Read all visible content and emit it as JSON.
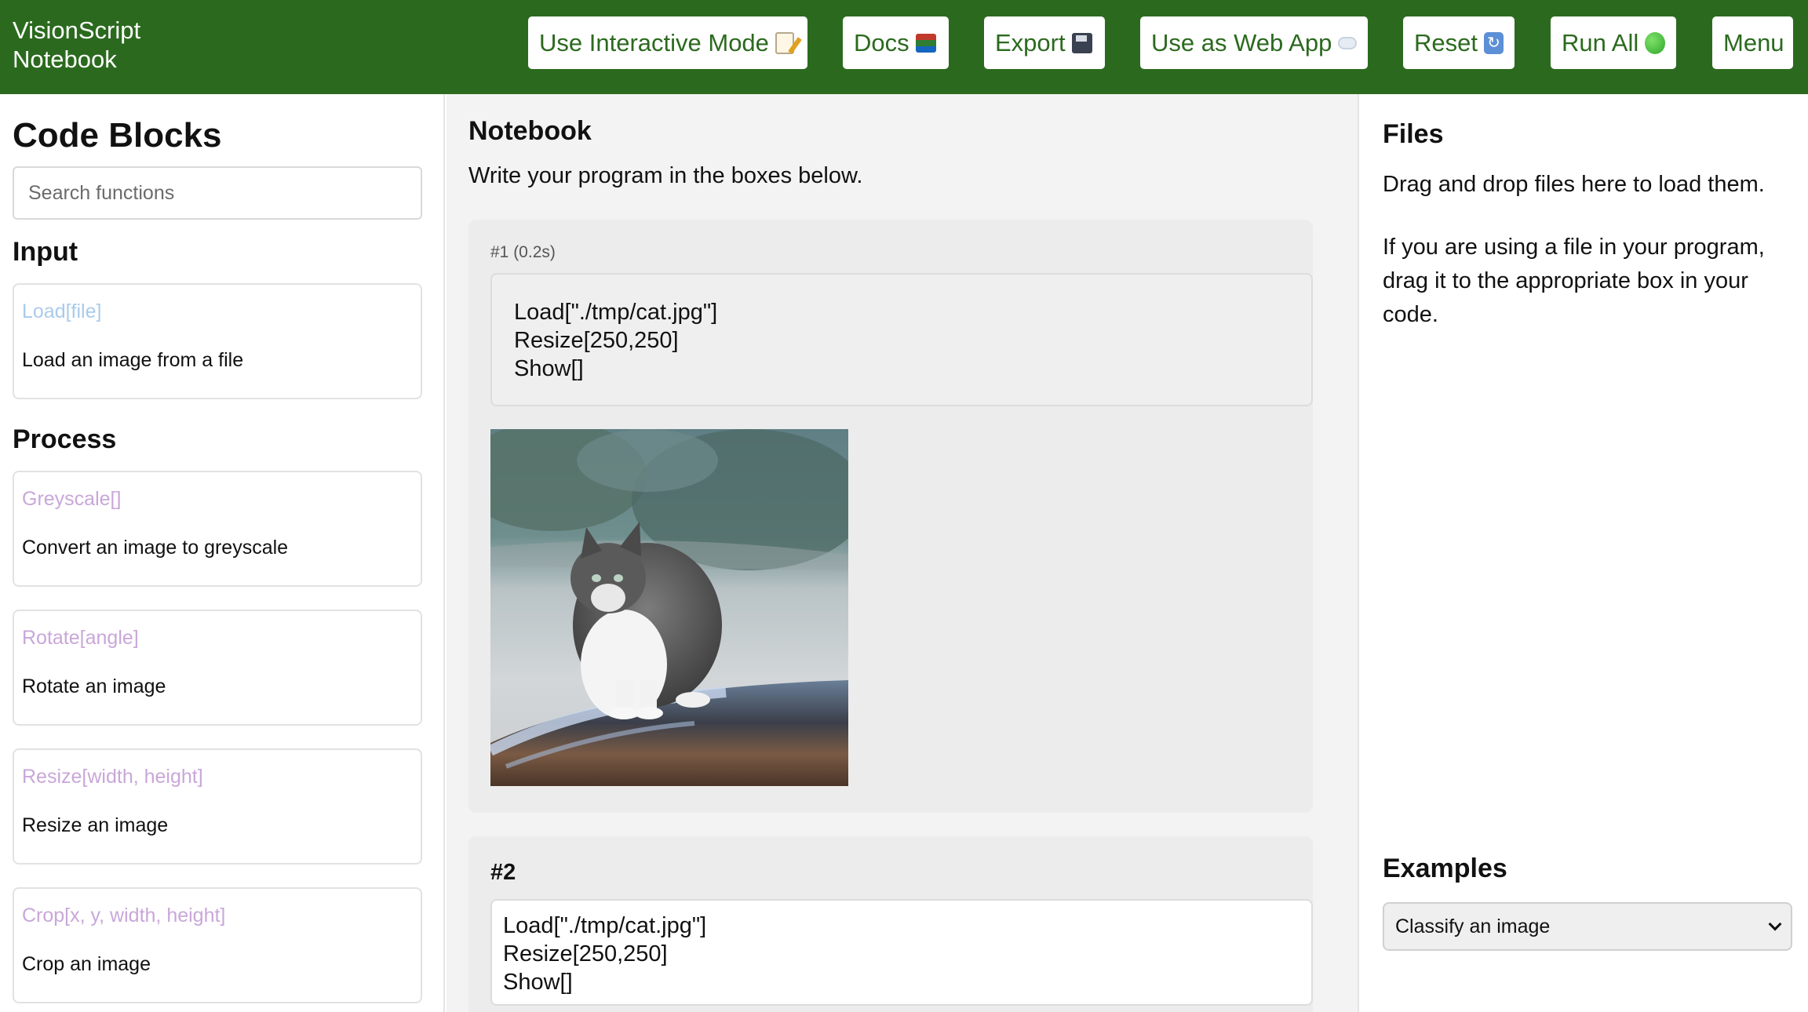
{
  "header": {
    "brand_line1": "VisionScript",
    "brand_line2": "Notebook",
    "buttons": [
      {
        "label": "Use Interactive Mode",
        "icon": "memo-icon"
      },
      {
        "label": "Docs",
        "icon": "books-icon"
      },
      {
        "label": "Export",
        "icon": "floppy-disk-icon"
      },
      {
        "label": "Use as Web App",
        "icon": "cloud-icon"
      },
      {
        "label": "Reset",
        "icon": "refresh-icon"
      },
      {
        "label": "Run All",
        "icon": "green-circle-icon"
      },
      {
        "label": "Menu"
      }
    ],
    "colors": {
      "bar": "#2b6a1e",
      "button_text": "#2b6a1e"
    }
  },
  "sidebar": {
    "title": "Code Blocks",
    "search_placeholder": "Search functions",
    "sections": [
      {
        "heading": "Input",
        "blocks": [
          {
            "signature": "Load[file]",
            "description": "Load an image from a file"
          }
        ]
      },
      {
        "heading": "Process",
        "blocks": [
          {
            "signature": "Greyscale[]",
            "description": "Convert an image to greyscale"
          },
          {
            "signature": "Rotate[angle]",
            "description": "Rotate an image"
          },
          {
            "signature": "Resize[width, height]",
            "description": "Resize an image"
          },
          {
            "signature": "Crop[x, y, width, height]",
            "description": "Crop an image"
          }
        ]
      }
    ]
  },
  "notebook": {
    "title": "Notebook",
    "subtitle": "Write your program in the boxes below.",
    "cells": [
      {
        "label": "#1 (0.2s)",
        "code": "Load[\"./tmp/cat.jpg\"]\nResize[250,250]\nShow[]",
        "output": "cat-photo"
      },
      {
        "label": "#2",
        "code": "Load[\"./tmp/cat.jpg\"]\nResize[250,250]\nShow[]"
      }
    ]
  },
  "files": {
    "title": "Files",
    "drop_text": "Drag and drop files here to load them.",
    "help_text": "If you are using a file in your program, drag it to the appropriate box in your code.",
    "examples_title": "Examples",
    "examples_selected": "Classify an image"
  }
}
